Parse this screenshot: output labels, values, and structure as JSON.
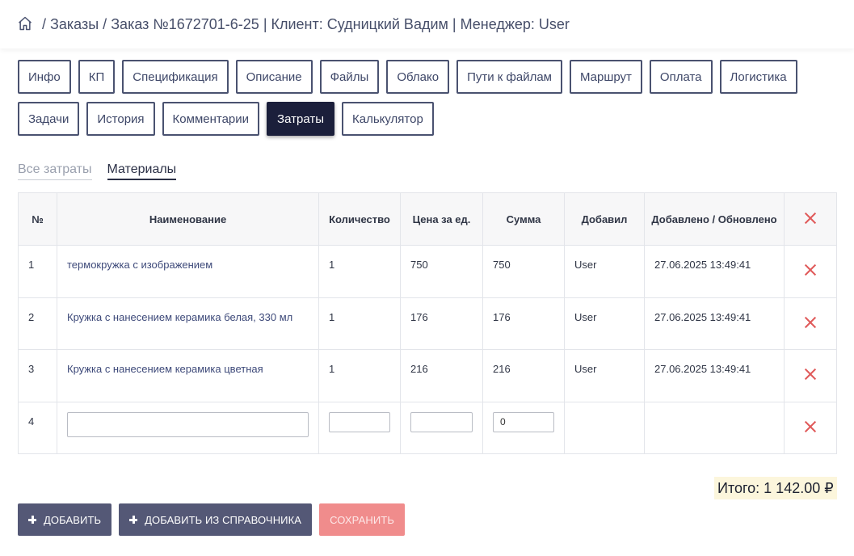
{
  "breadcrumb": {
    "separator": "/",
    "orders": "Заказы",
    "order": "Заказ №1672701-6-25",
    "client": "Клиент: Судницкий Вадим",
    "manager": "Менеджер: User",
    "bar": "|"
  },
  "tabs": {
    "row1": [
      "Инфо",
      "КП",
      "Спецификация",
      "Описание",
      "Файлы",
      "Облако",
      "Пути к файлам",
      "Маршрут",
      "Оплата",
      "Логистика"
    ],
    "row2": [
      "Задачи",
      "История",
      "Комментарии",
      "Затраты",
      "Калькулятор"
    ],
    "active": "Затраты"
  },
  "subtabs": {
    "all": "Все затраты",
    "materials": "Материалы"
  },
  "table": {
    "headers": {
      "num": "№",
      "name": "Наименование",
      "qty": "Количество",
      "price": "Цена за ед.",
      "sum": "Сумма",
      "added_by": "Добавил",
      "dates": "Добавлено / Обновлено"
    },
    "rows": [
      {
        "num": "1",
        "name": "термокружка с изображением",
        "qty": "1",
        "price": "750",
        "sum": "750",
        "added_by": "User",
        "date": "27.06.2025 13:49:41"
      },
      {
        "num": "2",
        "name": "Кружка с нанесением керамика белая, 330 мл",
        "qty": "1",
        "price": "176",
        "sum": "176",
        "added_by": "User",
        "date": "27.06.2025 13:49:41"
      },
      {
        "num": "3",
        "name": "Кружка с нанесением керамика цветная",
        "qty": "1",
        "price": "216",
        "sum": "216",
        "added_by": "User",
        "date": "27.06.2025 13:49:41"
      }
    ],
    "new_row": {
      "num": "4",
      "name": "",
      "qty": "",
      "price": "",
      "sum": "0"
    }
  },
  "total": "Итого: 1 142.00 ₽",
  "buttons": {
    "add": "ДОБАВИТЬ",
    "add_from_ref": "ДОБАВИТЬ ИЗ СПРАВОЧНИКА",
    "save": "СОХРАНИТЬ"
  },
  "colors": {
    "active_tab": "#1b1f3b",
    "delete": "#e05a5a",
    "button_dark": "#545876",
    "button_save": "#f08c8c",
    "total_bg": "#fcf6dc"
  }
}
